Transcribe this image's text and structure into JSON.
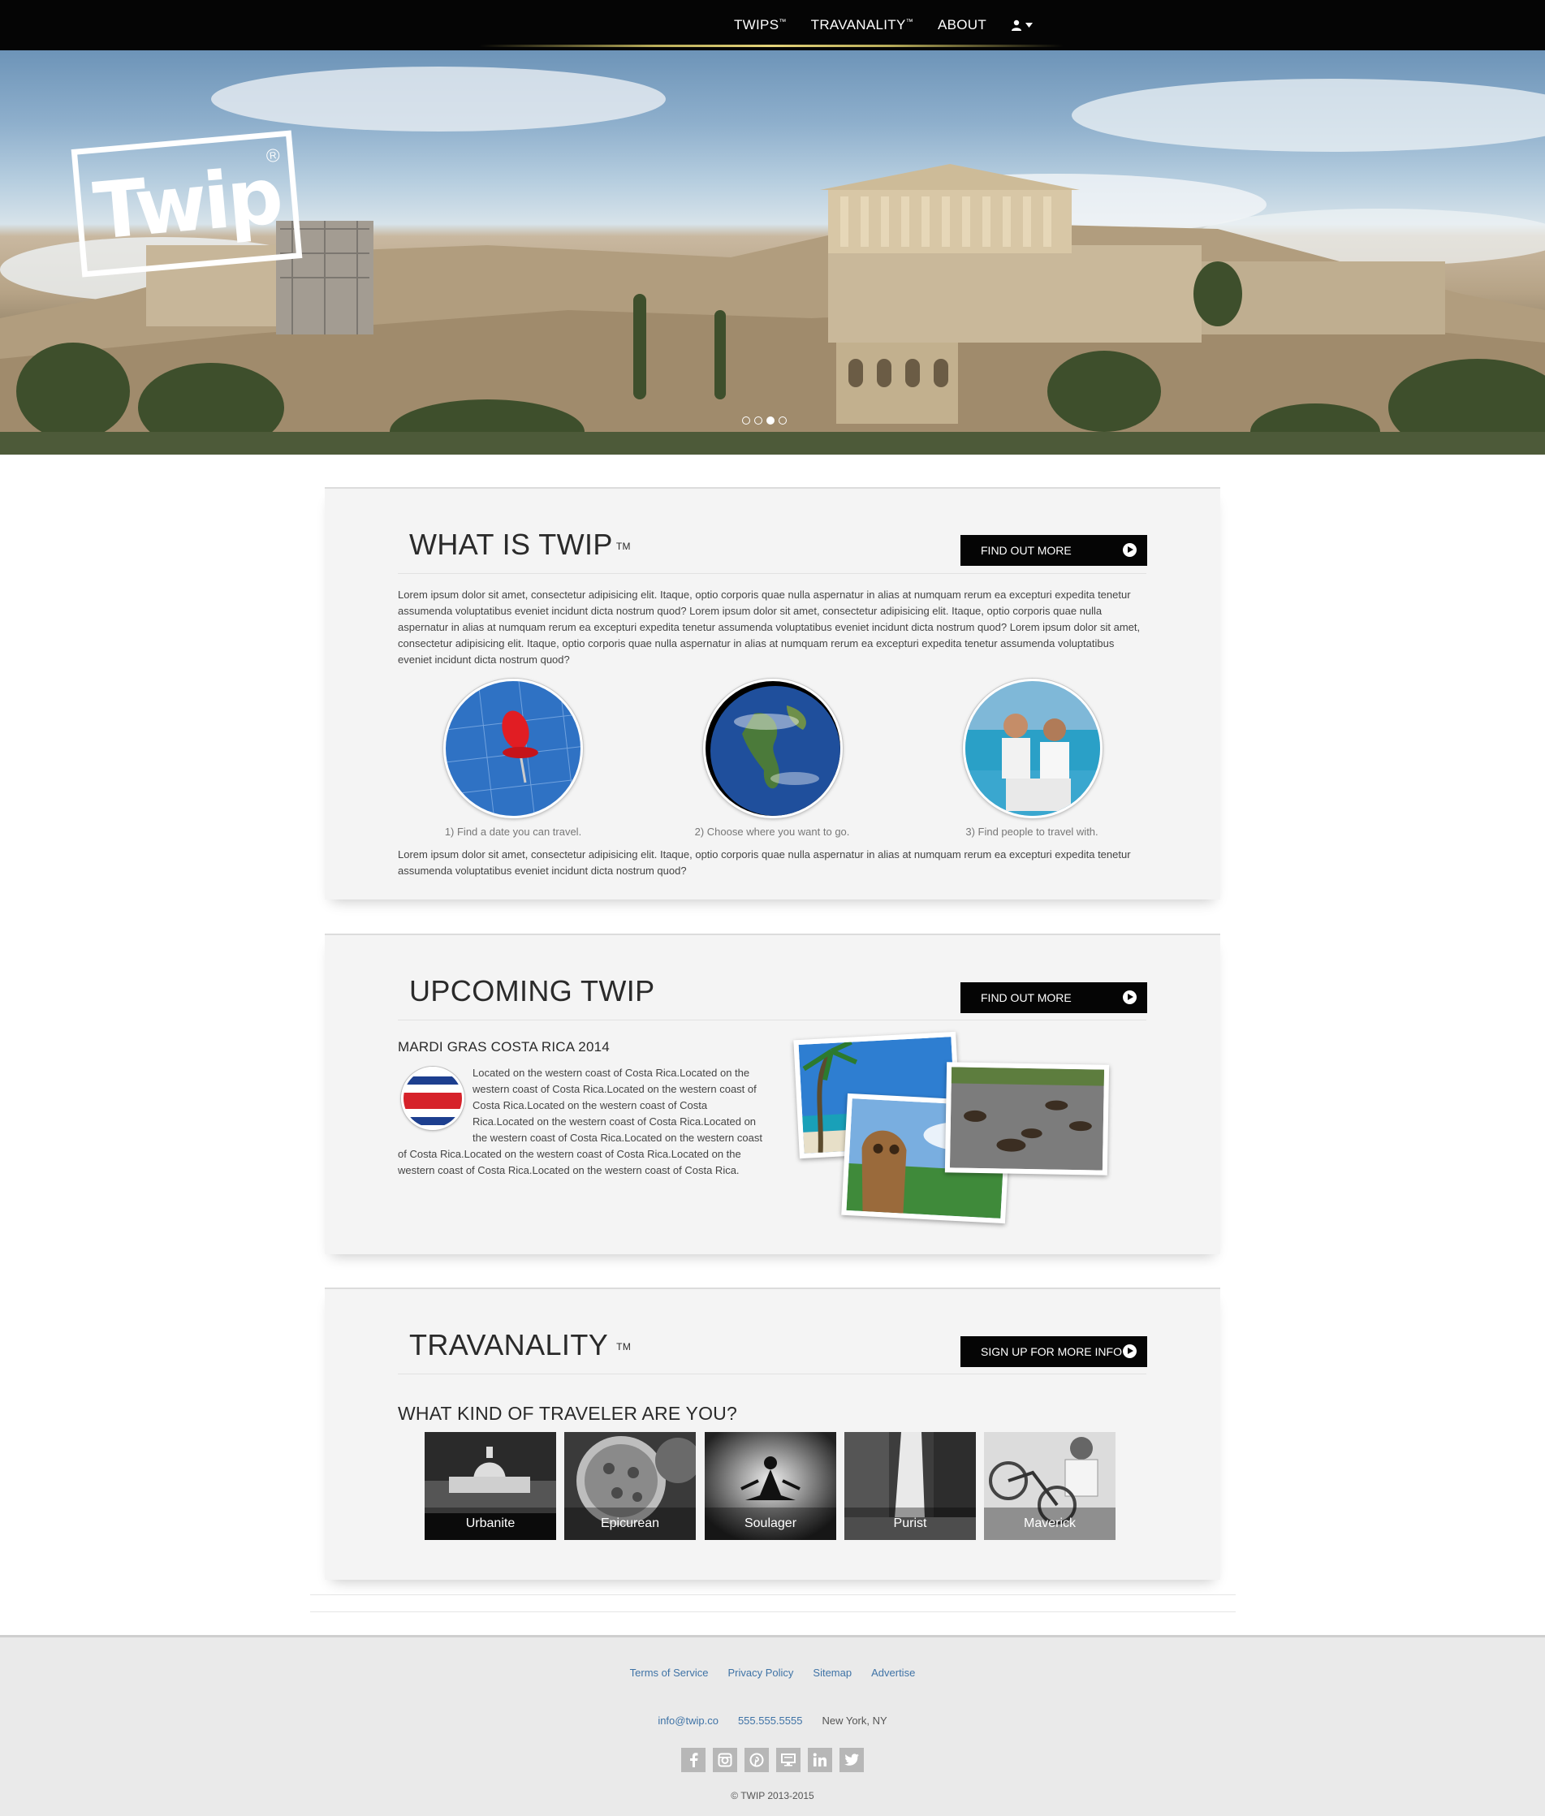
{
  "nav": {
    "items": [
      {
        "label": "TWIPS",
        "tm": "™"
      },
      {
        "label": "TRAVANALITY",
        "tm": "™"
      },
      {
        "label": "ABOUT",
        "tm": ""
      }
    ],
    "user_icon": "user-icon",
    "caret_icon": "caret-down-icon"
  },
  "hero": {
    "logo_text": "Twip",
    "logo_reg": "R",
    "slides_total": 4,
    "active_slide": 3
  },
  "what": {
    "title": "WHAT IS TWIP",
    "tm": "TM",
    "button": "FIND OUT MORE",
    "paragraph": "Lorem ipsum dolor sit amet, consectetur adipisicing elit. Itaque, optio corporis quae nulla aspernatur in alias at numquam rerum ea excepturi expedita tenetur assumenda voluptatibus eveniet incidunt dicta nostrum quod? Lorem ipsum dolor sit amet, consectetur adipisicing elit. Itaque, optio corporis quae nulla aspernatur in alias at numquam rerum ea excepturi expedita tenetur assumenda voluptatibus eveniet incidunt dicta nostrum quod? Lorem ipsum dolor sit amet, consectetur adipisicing elit. Itaque, optio corporis quae nulla aspernatur in alias at numquam rerum ea excepturi expedita tenetur assumenda voluptatibus eveniet incidunt dicta nostrum quod?",
    "steps": [
      "1) Find a date you can travel.",
      "2) Choose where you want to go.",
      "3) Find people to travel with."
    ],
    "paragraph2": "Lorem ipsum dolor sit amet, consectetur adipisicing elit. Itaque, optio corporis quae nulla aspernatur in alias at numquam rerum ea excepturi expedita tenetur assumenda voluptatibus eveniet incidunt dicta nostrum quod?"
  },
  "upcoming": {
    "title": "UPCOMING TWIP",
    "button": "FIND OUT MORE",
    "trip_name": "MARDI GRAS COSTA RICA 2014",
    "description": "Located on the western coast of Costa Rica.Located on the western coast of Costa Rica.Located on the western coast of Costa Rica.Located on the western coast of Costa Rica.Located on the western coast of Costa Rica.Located on the western coast of Costa Rica.Located on the western coast of Costa Rica.Located on the western coast of Costa Rica.Located on the western coast of Costa Rica.Located on the western coast of Costa Rica."
  },
  "travanality": {
    "title": "TRAVANALITY",
    "tm": "TM",
    "button": "SIGN UP FOR MORE INFO",
    "question": "WHAT KIND OF TRAVELER ARE YOU?",
    "types": [
      "Urbanite",
      "Epicurean",
      "Soulager",
      "Purist",
      "Maverick"
    ]
  },
  "footer": {
    "links": [
      "Terms of Service",
      "Privacy Policy",
      "Sitemap",
      "Advertise"
    ],
    "email": "info@twip.co",
    "phone": "555.555.5555",
    "location": "New York, NY",
    "social": [
      "facebook-icon",
      "instagram-icon",
      "pinterest-icon",
      "blog-icon",
      "linkedin-icon",
      "twitter-icon"
    ],
    "copyright": "© TWIP 2013-2015"
  },
  "colors": {
    "nav_bg": "#050505",
    "button_bg": "#050505",
    "link": "#3f73a6",
    "panel_bg": "#f4f4f4",
    "footer_bg": "#eaeaea"
  }
}
